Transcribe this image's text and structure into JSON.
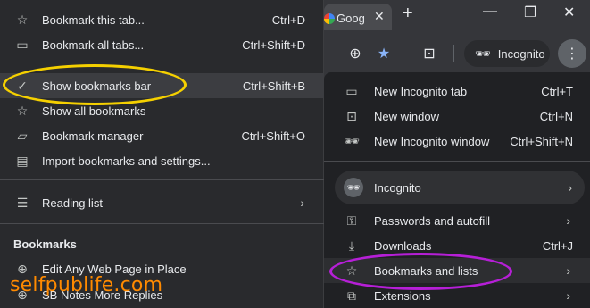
{
  "browser": {
    "tab_title": "Goog",
    "toolbar": {
      "incognito_chip_label": "Incognito"
    }
  },
  "bookmarks_menu": {
    "items": [
      {
        "label": "Bookmark this tab...",
        "shortcut": "Ctrl+D",
        "icon": "star-outline-icon"
      },
      {
        "label": "Bookmark all tabs...",
        "shortcut": "Ctrl+Shift+D",
        "icon": "star-folder-icon"
      },
      {
        "label": "Show bookmarks bar",
        "shortcut": "Ctrl+Shift+B",
        "icon": "check-icon"
      },
      {
        "label": "Show all bookmarks",
        "shortcut": "",
        "icon": "star-outline-icon"
      },
      {
        "label": "Bookmark manager",
        "shortcut": "Ctrl+Shift+O",
        "icon": "folder-icon"
      },
      {
        "label": "Import bookmarks and settings...",
        "shortcut": "",
        "icon": "import-icon"
      }
    ],
    "reading_list": {
      "label": "Reading list",
      "icon": "reading-list-icon"
    },
    "section_title": "Bookmarks",
    "bookmarks": [
      {
        "label": "Edit Any Web Page in Place",
        "icon": "globe-icon"
      },
      {
        "label": "SB Notes More Replies",
        "icon": "globe-icon"
      }
    ]
  },
  "chrome_menu": {
    "items_top": [
      {
        "label": "New Incognito tab",
        "shortcut": "Ctrl+T",
        "icon": "new-tab-icon"
      },
      {
        "label": "New window",
        "shortcut": "Ctrl+N",
        "icon": "new-window-icon"
      },
      {
        "label": "New Incognito window",
        "shortcut": "Ctrl+Shift+N",
        "icon": "incognito-icon"
      }
    ],
    "profile": {
      "label": "Incognito",
      "icon": "incognito-icon"
    },
    "items_bottom": [
      {
        "label": "Passwords and autofill",
        "shortcut": "",
        "icon": "key-icon"
      },
      {
        "label": "Downloads",
        "shortcut": "Ctrl+J",
        "icon": "download-icon"
      },
      {
        "label": "Bookmarks and lists",
        "shortcut": "",
        "icon": "star-outline-icon"
      },
      {
        "label": "Extensions",
        "shortcut": "",
        "icon": "puzzle-icon"
      }
    ]
  },
  "annotations": {
    "highlight_yellow": "#f5d000",
    "highlight_purple": "#b61fd7"
  },
  "watermark": {
    "text": "selfpublife.com",
    "color": "#ff8a00"
  }
}
